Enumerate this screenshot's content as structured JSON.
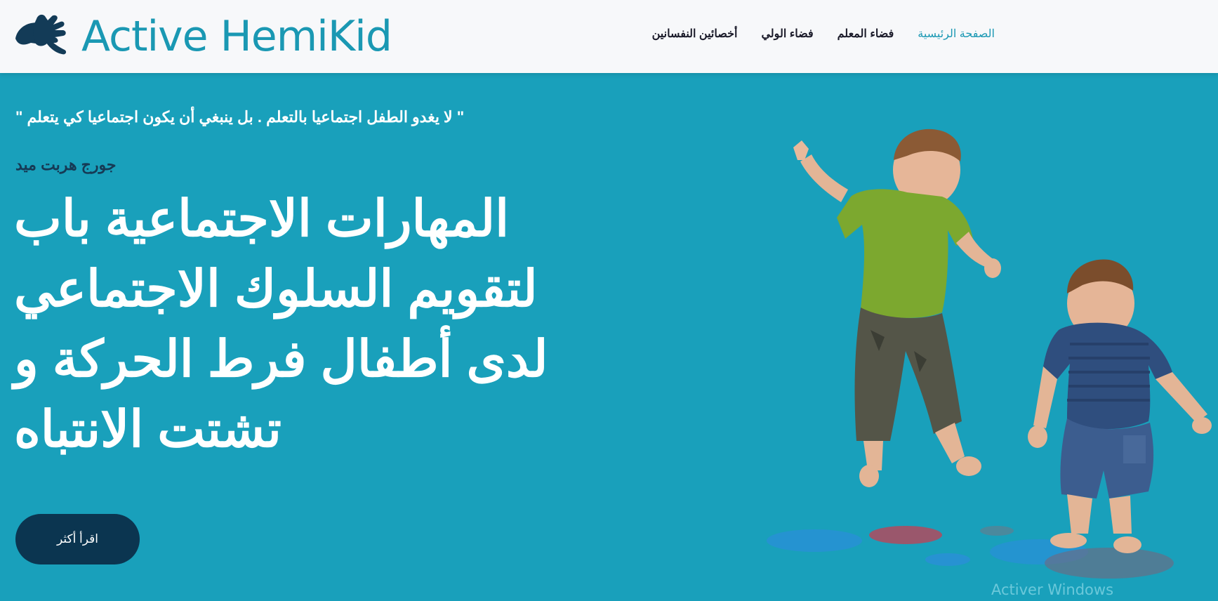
{
  "brand": {
    "name": "Active HemiKid",
    "logo_icon": "hands-sign-language-icon",
    "color": "#1a98b3"
  },
  "nav": {
    "items": [
      {
        "label": "الصفحة الرئيسية",
        "active": true
      },
      {
        "label": "فضاء المعلم",
        "active": false
      },
      {
        "label": "فضاء الولي",
        "active": false
      },
      {
        "label": "أخصائين النفسانين",
        "active": false
      }
    ]
  },
  "hero": {
    "quote": "\" لا يغدو الطفل اجتماعيا بالتعلم . بل ينبغي أن يكون اجتماعيا كي يتعلم \"",
    "author": "جورج هربت ميد",
    "headline": "المهارات الاجتماعية باب لتقويم السلوك الاجتماعي لدى أطفال فرط الحركة و تشتت الانتباه",
    "cta_label": "اقرأ أكثر",
    "image": "two-children-jumping-playing-image"
  },
  "watermark": "Activer Windows",
  "colors": {
    "hero_bg": "#19a0bb",
    "navbar_bg": "#f7f8fa",
    "cta_bg": "#0b3550",
    "author": "#163a55"
  }
}
